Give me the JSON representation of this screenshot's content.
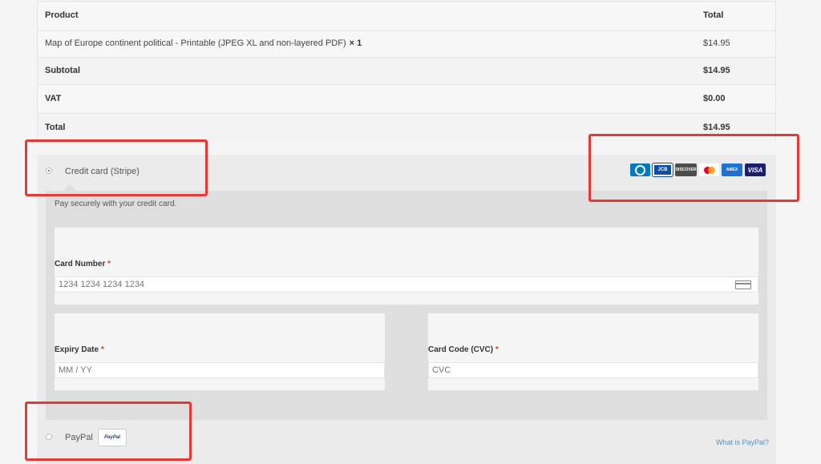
{
  "order": {
    "header_product": "Product",
    "header_total": "Total",
    "item_name": "Map of Europe continent political - Printable (JPEG XL and non-layered PDF)",
    "item_qty": "× 1",
    "item_total": "$14.95",
    "subtotal_label": "Subtotal",
    "subtotal_value": "$14.95",
    "vat_label": "VAT",
    "vat_value": "$0.00",
    "total_label": "Total",
    "total_value": "$14.95"
  },
  "payment": {
    "stripe_label": "Credit card (Stripe)",
    "stripe_description": "Pay securely with your credit card.",
    "card_number_label": "Card Number",
    "card_number_placeholder": "1234 1234 1234 1234",
    "expiry_label": "Expiry Date",
    "expiry_placeholder": "MM / YY",
    "cvc_label": "Card Code (CVC)",
    "cvc_placeholder": "CVC",
    "required_mark": "*",
    "paypal_label": "PayPal",
    "paypal_badge": "PayPal",
    "what_is_paypal": "What is PayPal?",
    "card_brands": [
      {
        "name": "diners-club",
        "text": "",
        "color": "#0079be"
      },
      {
        "name": "jcb",
        "text": "JCB",
        "color": "#0b4ea2"
      },
      {
        "name": "discover",
        "text": "DISCOVER",
        "color": "#4d4d4d"
      },
      {
        "name": "mastercard",
        "text": "",
        "color": "#ffffff"
      },
      {
        "name": "american-express",
        "text": "AMEX",
        "color": "#1f72cd"
      },
      {
        "name": "visa",
        "text": "VISA",
        "color": "#1a1f71"
      }
    ]
  },
  "colors": {
    "highlight": "#e53935",
    "required": "#e2401c",
    "link": "#5b8fb9"
  }
}
